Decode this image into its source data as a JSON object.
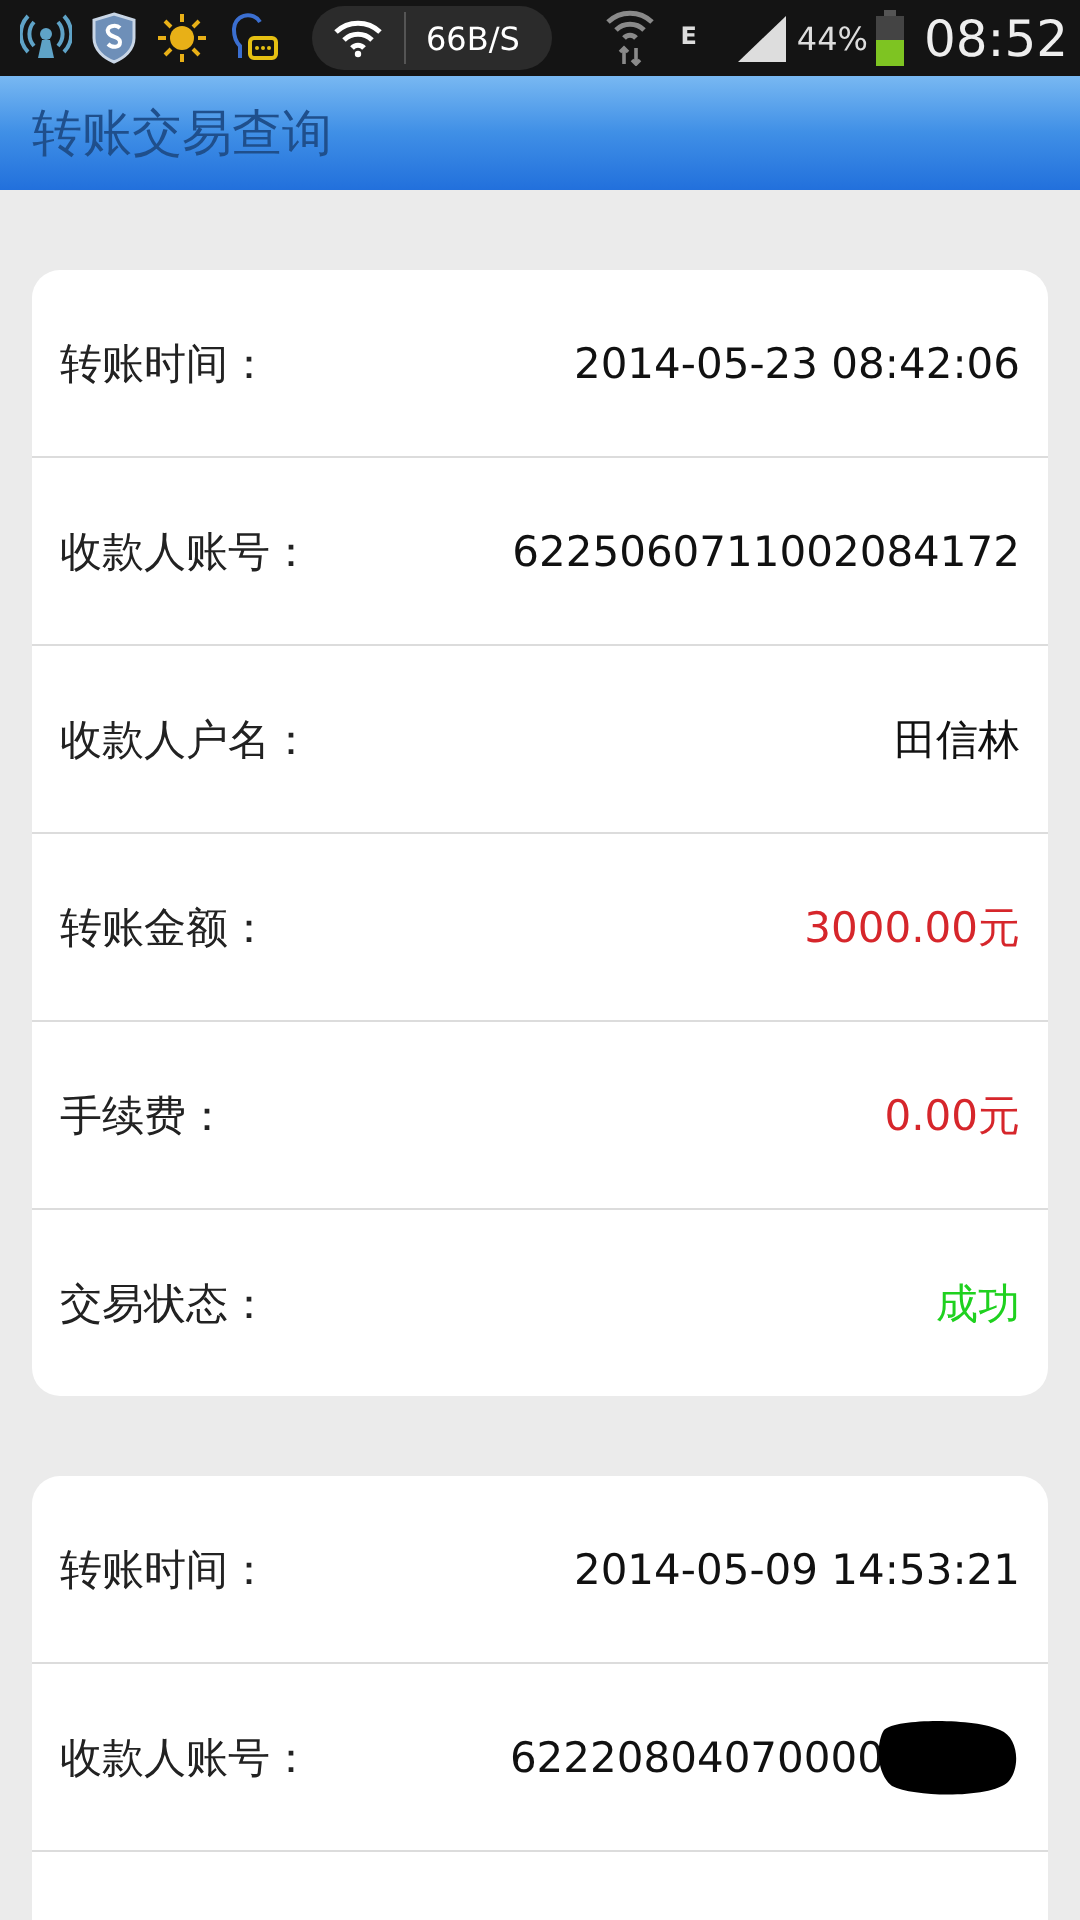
{
  "status_bar": {
    "speed": "66B/S",
    "network": "E",
    "battery": "44%",
    "time": "08:52"
  },
  "header": {
    "title": "转账交易查询"
  },
  "records": [
    {
      "rows": [
        {
          "label": "转账时间：",
          "value": "2014-05-23 08:42:06",
          "kind": "plain"
        },
        {
          "label": "收款人账号：",
          "value": "6225060711002084172",
          "kind": "plain"
        },
        {
          "label": "收款人户名：",
          "value": "田信林",
          "kind": "plain"
        },
        {
          "label": "转账金额：",
          "value": "3000.00元",
          "kind": "amount"
        },
        {
          "label": "手续费：",
          "value": "0.00元",
          "kind": "amount"
        },
        {
          "label": "交易状态：",
          "value": "成功",
          "kind": "success"
        }
      ]
    },
    {
      "rows": [
        {
          "label": "转账时间：",
          "value": "2014-05-09 14:53:21",
          "kind": "plain"
        },
        {
          "label": "收款人账号：",
          "value": "62220804070000",
          "kind": "redacted"
        }
      ]
    }
  ]
}
